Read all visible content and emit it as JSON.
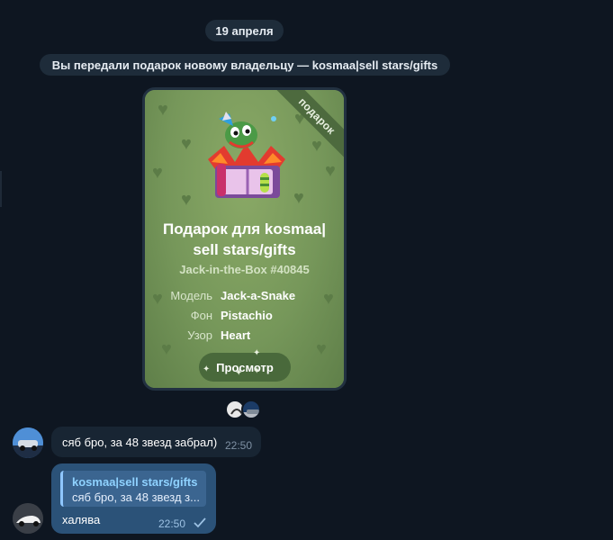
{
  "date_divider": "19 апреля",
  "service_message": "Вы передали подарок новому владельцу — kosmaa|sell stars/gifts",
  "gift": {
    "ribbon_label": "подарок",
    "title_line1": "Подарок для kosmaa|",
    "title_line2": "sell stars/gifts",
    "subtitle": "Jack-in-the-Box #40845",
    "attributes": [
      {
        "label": "Модель",
        "value": "Jack-a-Snake"
      },
      {
        "label": "Фон",
        "value": "Pistachio"
      },
      {
        "label": "Узор",
        "value": "Heart"
      }
    ],
    "view_button": "Просмотр",
    "background_color": "#76975a",
    "pattern_icon": "heart-icon"
  },
  "messages": {
    "incoming": {
      "text": "сяб бро, за 48 звезд забрал)",
      "time": "22:50"
    },
    "outgoing": {
      "reply_name": "kosmaa|sell stars/gifts",
      "reply_text": "сяб бро, за 48 звезд з...",
      "text": "халява",
      "time": "22:50",
      "status_icon": "check-icon"
    }
  },
  "colors": {
    "chat_background": "#0e1621",
    "incoming_bubble": "#182533",
    "outgoing_bubble": "#2b5278",
    "accent": "#8fd2ff"
  }
}
